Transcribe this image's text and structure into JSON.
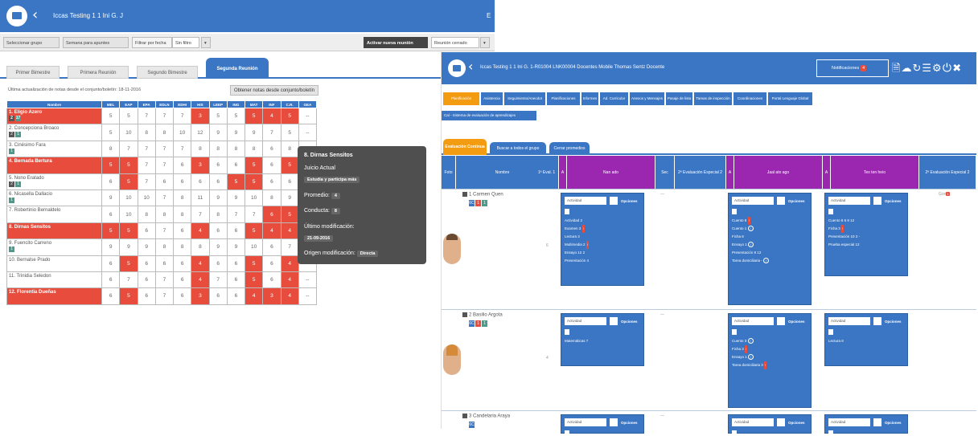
{
  "window1": {
    "title": "Iccas Testing 1 1 Ini G. J",
    "title_end": "E",
    "toolbar": {
      "b1": "Seleccionar grupo",
      "b2": "Semana para apuntes",
      "b3": "Filtrar por fecha",
      "b4": "Sin filtro",
      "b5": "▾",
      "b6": "Activar nueva reunión",
      "b7": "Reunión cerrado",
      "b8": "▾"
    },
    "tabs": [
      "Primer Bimestre",
      "Primera Reunión",
      "Segundo Bimestre",
      "Segunda Reunión"
    ],
    "info": "Última actualización de notas desde el conjunto/boletín: 18-11-2016",
    "action_button": "Obtener notas desde conjunto/boletín",
    "columns": [
      "Nombre",
      "MEL",
      "EAP",
      "EPA",
      "EDLN",
      "EDHI",
      "HIS",
      "LEEP",
      "ING",
      "MAT",
      "INF",
      "C.R.",
      "GEA"
    ],
    "rows": [
      {
        "name": "1. Eligio Azero",
        "red": true,
        "badges": [
          [
            "2",
            "d"
          ],
          [
            "17",
            "g"
          ]
        ],
        "cells": [
          "5",
          "5",
          "7",
          "7",
          "7",
          "3",
          "5",
          "5",
          "5",
          "4",
          "5",
          "--"
        ],
        "red_cells": [
          5,
          8,
          9,
          10
        ]
      },
      {
        "name": "2. Concepciona Broaco",
        "red": false,
        "badges": [
          [
            "2",
            "d"
          ],
          [
            "1",
            "g"
          ]
        ],
        "cells": [
          "5",
          "10",
          "8",
          "8",
          "10",
          "12",
          "9",
          "9",
          "9",
          "7",
          "5",
          "--"
        ],
        "red_cells": []
      },
      {
        "name": "3. Cinésimo Fara",
        "red": false,
        "badges": [
          [
            "1",
            "g"
          ]
        ],
        "cells": [
          "8",
          "7",
          "7",
          "7",
          "7",
          "8",
          "8",
          "8",
          "8",
          "6",
          "8",
          "--"
        ],
        "red_cells": []
      },
      {
        "name": "4. Bernada Bertura",
        "red": true,
        "badges": [],
        "cells": [
          "5",
          "5",
          "7",
          "7",
          "6",
          "3",
          "6",
          "6",
          "5",
          "6",
          "5",
          "--"
        ],
        "red_cells": [
          0,
          1,
          5,
          8,
          10
        ]
      },
      {
        "name": "5. Nono Eratado",
        "red": false,
        "badges": [
          [
            "2",
            "d"
          ],
          [
            "1",
            "g"
          ]
        ],
        "cells": [
          "6",
          "5",
          "7",
          "6",
          "6",
          "6",
          "6",
          "5",
          "5",
          "6",
          "6",
          "--"
        ],
        "red_cells": [
          1,
          7,
          8
        ]
      },
      {
        "name": "6. Nicasella Dallacio",
        "red": false,
        "badges": [
          [
            "1",
            "g"
          ]
        ],
        "cells": [
          "9",
          "10",
          "10",
          "7",
          "8",
          "11",
          "9",
          "9",
          "10",
          "8",
          "9",
          "--"
        ],
        "red_cells": []
      },
      {
        "name": "7. Robertinio Bernaldelo",
        "red": false,
        "badges": [],
        "cells": [
          "6",
          "10",
          "8",
          "8",
          "8",
          "7",
          "8",
          "7",
          "7",
          "6",
          "5",
          "--"
        ],
        "red_cells": [
          9,
          10
        ]
      },
      {
        "name": "8. Dirnas Sensitos",
        "red": true,
        "badges": [],
        "cells": [
          "5",
          "5",
          "6",
          "7",
          "6",
          "4",
          "6",
          "6",
          "5",
          "4",
          "4",
          "--"
        ],
        "red_cells": [
          0,
          1,
          5,
          8,
          9,
          10
        ]
      },
      {
        "name": "9. Fuencito Carreno",
        "red": false,
        "badges": [
          [
            "1",
            "g"
          ]
        ],
        "cells": [
          "9",
          "9",
          "9",
          "8",
          "8",
          "8",
          "9",
          "9",
          "10",
          "6",
          "7",
          "--"
        ],
        "red_cells": []
      },
      {
        "name": "10. Bernalse Prado",
        "red": false,
        "badges": [],
        "cells": [
          "6",
          "5",
          "6",
          "6",
          "6",
          "4",
          "6",
          "6",
          "5",
          "6",
          "4",
          "--"
        ],
        "red_cells": [
          1,
          5,
          8,
          10
        ]
      },
      {
        "name": "11. Trinidia Seledon",
        "red": false,
        "badges": [],
        "cells": [
          "6",
          "7",
          "6",
          "7",
          "6",
          "4",
          "7",
          "6",
          "5",
          "6",
          "4",
          "--"
        ],
        "red_cells": [
          5,
          8,
          10
        ]
      },
      {
        "name": "12. Florentia Dueñas",
        "red": true,
        "badges": [],
        "cells": [
          "6",
          "5",
          "6",
          "7",
          "6",
          "3",
          "6",
          "6",
          "4",
          "3",
          "4",
          "--"
        ],
        "red_cells": [
          1,
          5,
          8,
          9,
          10
        ]
      }
    ],
    "popup": {
      "name": "8. Dirnas Sensitos",
      "juicio_label": "Juicio Actual",
      "juicio_value": "Estudia y participa más",
      "promedio_label": "Promedio:",
      "promedio_value": "4",
      "conducta_label": "Conducta:",
      "conducta_value": "8",
      "ultima_label": "Último modificación:",
      "ultima_value": "21-09-2016",
      "origen_label": "Origen modificación:",
      "origen_value": "Directa"
    }
  },
  "window2": {
    "title": "Iccas Testing 1 1 Ini G. 1-R01004 LNK00004 Docentes Mobile Thomas Sentz Docente",
    "notif_label": "Notificaciones",
    "notif_count": "4",
    "header_icons": "🗎☁↻☰⚙⏻✖",
    "nav": [
      "Planificación",
      "Asistencia",
      "Seguimiento/Anecdot",
      "Planificaciones",
      "Informes",
      "Ad. Curricular",
      "Anexos y Mensajes",
      "Pasaje de lista",
      "Tareas de inspección",
      "Coordinaciones",
      "Portal Lenguaje Global"
    ],
    "nav_sub": "Cal - Sistema de evaluación de aprendizajes",
    "tabs": [
      "Evaluación Continua",
      "Buscar a todos el grupo",
      "Cerrar promedios"
    ],
    "col_headers": [
      "Foto",
      "Nombre",
      "1ª Eval. 1",
      "A",
      "Nan ado",
      "Sec",
      "2ª Evaluación Especial 2",
      "A",
      "Jaal ato ago",
      "A",
      "Tex ten heio",
      "2ª Evaluación Especial 2"
    ],
    "students": [
      {
        "name": "1 Carmen Quen",
        "badges": [
          [
            "6C",
            "b"
          ],
          [
            "1",
            "r"
          ],
          [
            "1",
            "g"
          ]
        ],
        "score": "6",
        "final": "Gon",
        "final_badge": "1",
        "card1": {
          "sel": "Actividad",
          "op": "Opciones",
          "items": [
            [
              "Actividad",
              "2",
              ""
            ],
            [
              "Examen",
              "3",
              "r"
            ],
            [
              "Lectura",
              "3",
              ""
            ],
            [
              "Multimedia",
              "2",
              "r"
            ],
            [
              "Ensayo",
              "12",
              "2"
            ],
            [
              "Presentación",
              "4",
              ""
            ]
          ]
        },
        "card2": {
          "sel": "Actividad",
          "op": "Opciones",
          "items": [
            [
              "Cuento",
              "8",
              "r"
            ],
            [
              "Cuento",
              "1",
              "c"
            ],
            [
              "Ficha",
              "8",
              ""
            ],
            [
              "Ensayo",
              "1",
              "c"
            ],
            [
              "Presentación",
              "8",
              "12"
            ],
            [
              "Tarea domiciliaria",
              "-",
              "c"
            ]
          ]
        },
        "card3": {
          "sel": "Actividad",
          "op": "Opciones",
          "items": [
            [
              "Cuento",
              "8",
              "6 8 12"
            ],
            [
              "Ficha",
              "3",
              "r"
            ],
            [
              "Presentación",
              "10",
              "2 -"
            ],
            [
              "Prueba especial",
              "12",
              ""
            ]
          ]
        }
      },
      {
        "name": "2 Basilio Argota",
        "badges": [
          [
            "6C",
            "b"
          ],
          [
            "1",
            "r"
          ],
          [
            "1",
            "g"
          ]
        ],
        "score": "4",
        "final": "",
        "final_badge": "",
        "card1": {
          "sel": "Actividad",
          "op": "Opciones",
          "items": [
            [
              "Matemáticas",
              "7",
              ""
            ]
          ]
        },
        "card2": {
          "sel": "Actividad",
          "op": "Opciones",
          "items": [
            [
              "Cuento",
              "3",
              "c"
            ],
            [
              "Ficha",
              "3",
              "r"
            ],
            [
              "Ensayo",
              "1",
              "c"
            ],
            [
              "Tarea domiciliaria",
              "3",
              "r"
            ]
          ]
        },
        "card3": {
          "sel": "Actividad",
          "op": "Opciones",
          "items": [
            [
              "Lectura",
              "8",
              ""
            ]
          ]
        }
      },
      {
        "name": "3 Candelaria Araya",
        "badges": [
          [
            "6C",
            "b"
          ]
        ],
        "score": "",
        "final": "",
        "final_badge": "",
        "card1": {
          "sel": "Actividad",
          "op": "Opciones",
          "items": []
        },
        "card2": {
          "sel": "Actividad",
          "op": "Opciones",
          "items": []
        },
        "card3": {
          "sel": "Actividad",
          "op": "Opciones",
          "items": []
        }
      }
    ]
  },
  "colors": {
    "primary": "#3a76c4",
    "danger": "#e74c3c",
    "purple": "#9b27b0",
    "orange": "#f39c12",
    "popup": "#4f4f4f"
  }
}
